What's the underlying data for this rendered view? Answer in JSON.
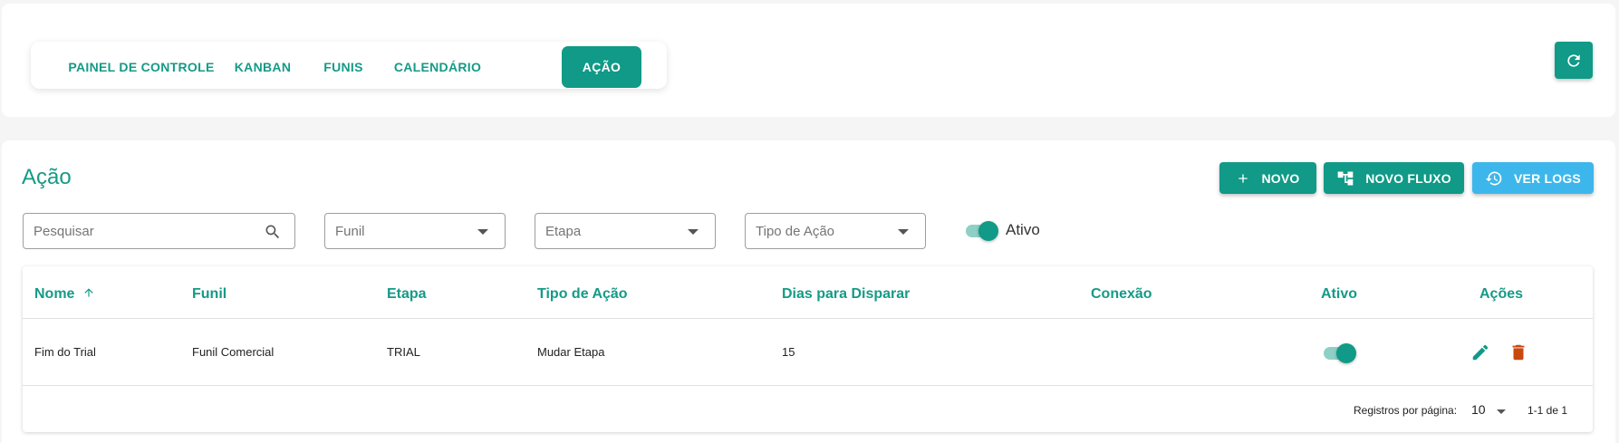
{
  "tabs": [
    {
      "label": "PAINEL DE CONTROLE"
    },
    {
      "label": "KANBAN"
    },
    {
      "label": "FUNIS"
    },
    {
      "label": "CALENDÁRIO"
    },
    {
      "label": "AÇÃO",
      "active": true
    }
  ],
  "refresh": {
    "icon": "refresh-icon"
  },
  "page": {
    "title": "Ação"
  },
  "actions": {
    "new_label": "NOVO",
    "new_flow_label": "NOVO FLUXO",
    "logs_label": "VER LOGS"
  },
  "filters": {
    "search_placeholder": "Pesquisar",
    "funil_placeholder": "Funil",
    "etapa_placeholder": "Etapa",
    "tipo_placeholder": "Tipo de Ação",
    "active_label": "Ativo",
    "active_on": true
  },
  "table": {
    "headers": [
      "Nome",
      "Funil",
      "Etapa",
      "Tipo de Ação",
      "Dias para Disparar",
      "Conexão",
      "Ativo",
      "Ações"
    ],
    "sort": {
      "column": "Nome",
      "direction": "asc"
    },
    "rows": [
      {
        "nome": "Fim do Trial",
        "funil": "Funil Comercial",
        "etapa": "TRIAL",
        "tipo": "Mudar Etapa",
        "dias": "15",
        "conexao": "",
        "ativo": true
      }
    ],
    "footer": {
      "rows_per_page_label": "Registros por página:",
      "rows_per_page": "10",
      "range": "1-1 de 1"
    }
  },
  "colors": {
    "primary": "#109a87",
    "info": "#3db7eb",
    "danger": "#c9480f"
  }
}
